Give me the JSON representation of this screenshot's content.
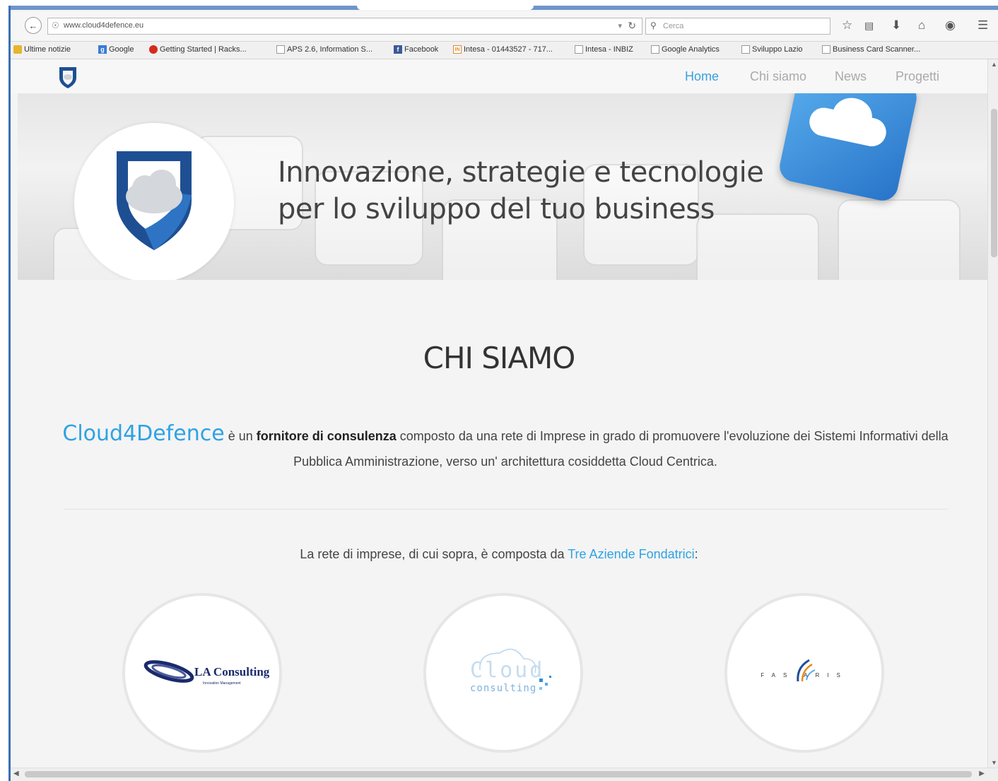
{
  "browser": {
    "url": "www.cloud4defence.eu",
    "search_placeholder": "Cerca",
    "bookmarks": [
      {
        "label": "Ultime notizie",
        "icon": "folder-icon"
      },
      {
        "label": "Google",
        "icon": "google-icon"
      },
      {
        "label": "Getting Started | Racks...",
        "icon": "opera-icon"
      },
      {
        "label": "APS 2.6, Information S...",
        "icon": "page-icon"
      },
      {
        "label": "Facebook",
        "icon": "facebook-icon"
      },
      {
        "label": "Intesa - 01443527 - 717...",
        "icon": "intesa-icon"
      },
      {
        "label": "Intesa - INBIZ",
        "icon": "page-icon"
      },
      {
        "label": "Google Analytics",
        "icon": "page-icon"
      },
      {
        "label": "Sviluppo Lazio",
        "icon": "page-icon"
      },
      {
        "label": "Business Card Scanner...",
        "icon": "page-icon"
      }
    ]
  },
  "site": {
    "menu": [
      {
        "label": "Home",
        "active": true
      },
      {
        "label": "Chi siamo",
        "active": false
      },
      {
        "label": "News",
        "active": false
      },
      {
        "label": "Progetti",
        "active": false
      }
    ],
    "hero": {
      "line1": "Innovazione, strategie e tecnologie",
      "line2": "per lo sviluppo del tuo business"
    },
    "section_title": "CHI SIAMO",
    "intro": {
      "brand": "Cloud4Defence",
      "text1": " è un ",
      "bold": "fornitore di consulenza",
      "text2": " composto da una rete di Imprese in grado di promuovere l'evoluzione dei Sistemi Informativi della Pubblica Amministrazione, verso un' architettura cosiddetta Cloud Centrica."
    },
    "network": {
      "text": "La rete di imprese, di cui sopra, è composta da ",
      "highlight": "Tre Aziende Fondatrici",
      "end": ":"
    },
    "partners": [
      {
        "name": "LA Consulting",
        "sub": "Innovation Management"
      },
      {
        "name": "Cloud",
        "sub": "consulting"
      },
      {
        "name": "FAS ARIS"
      }
    ]
  },
  "colors": {
    "accent": "#2ea2e4",
    "frame": "#3b6fb4"
  }
}
